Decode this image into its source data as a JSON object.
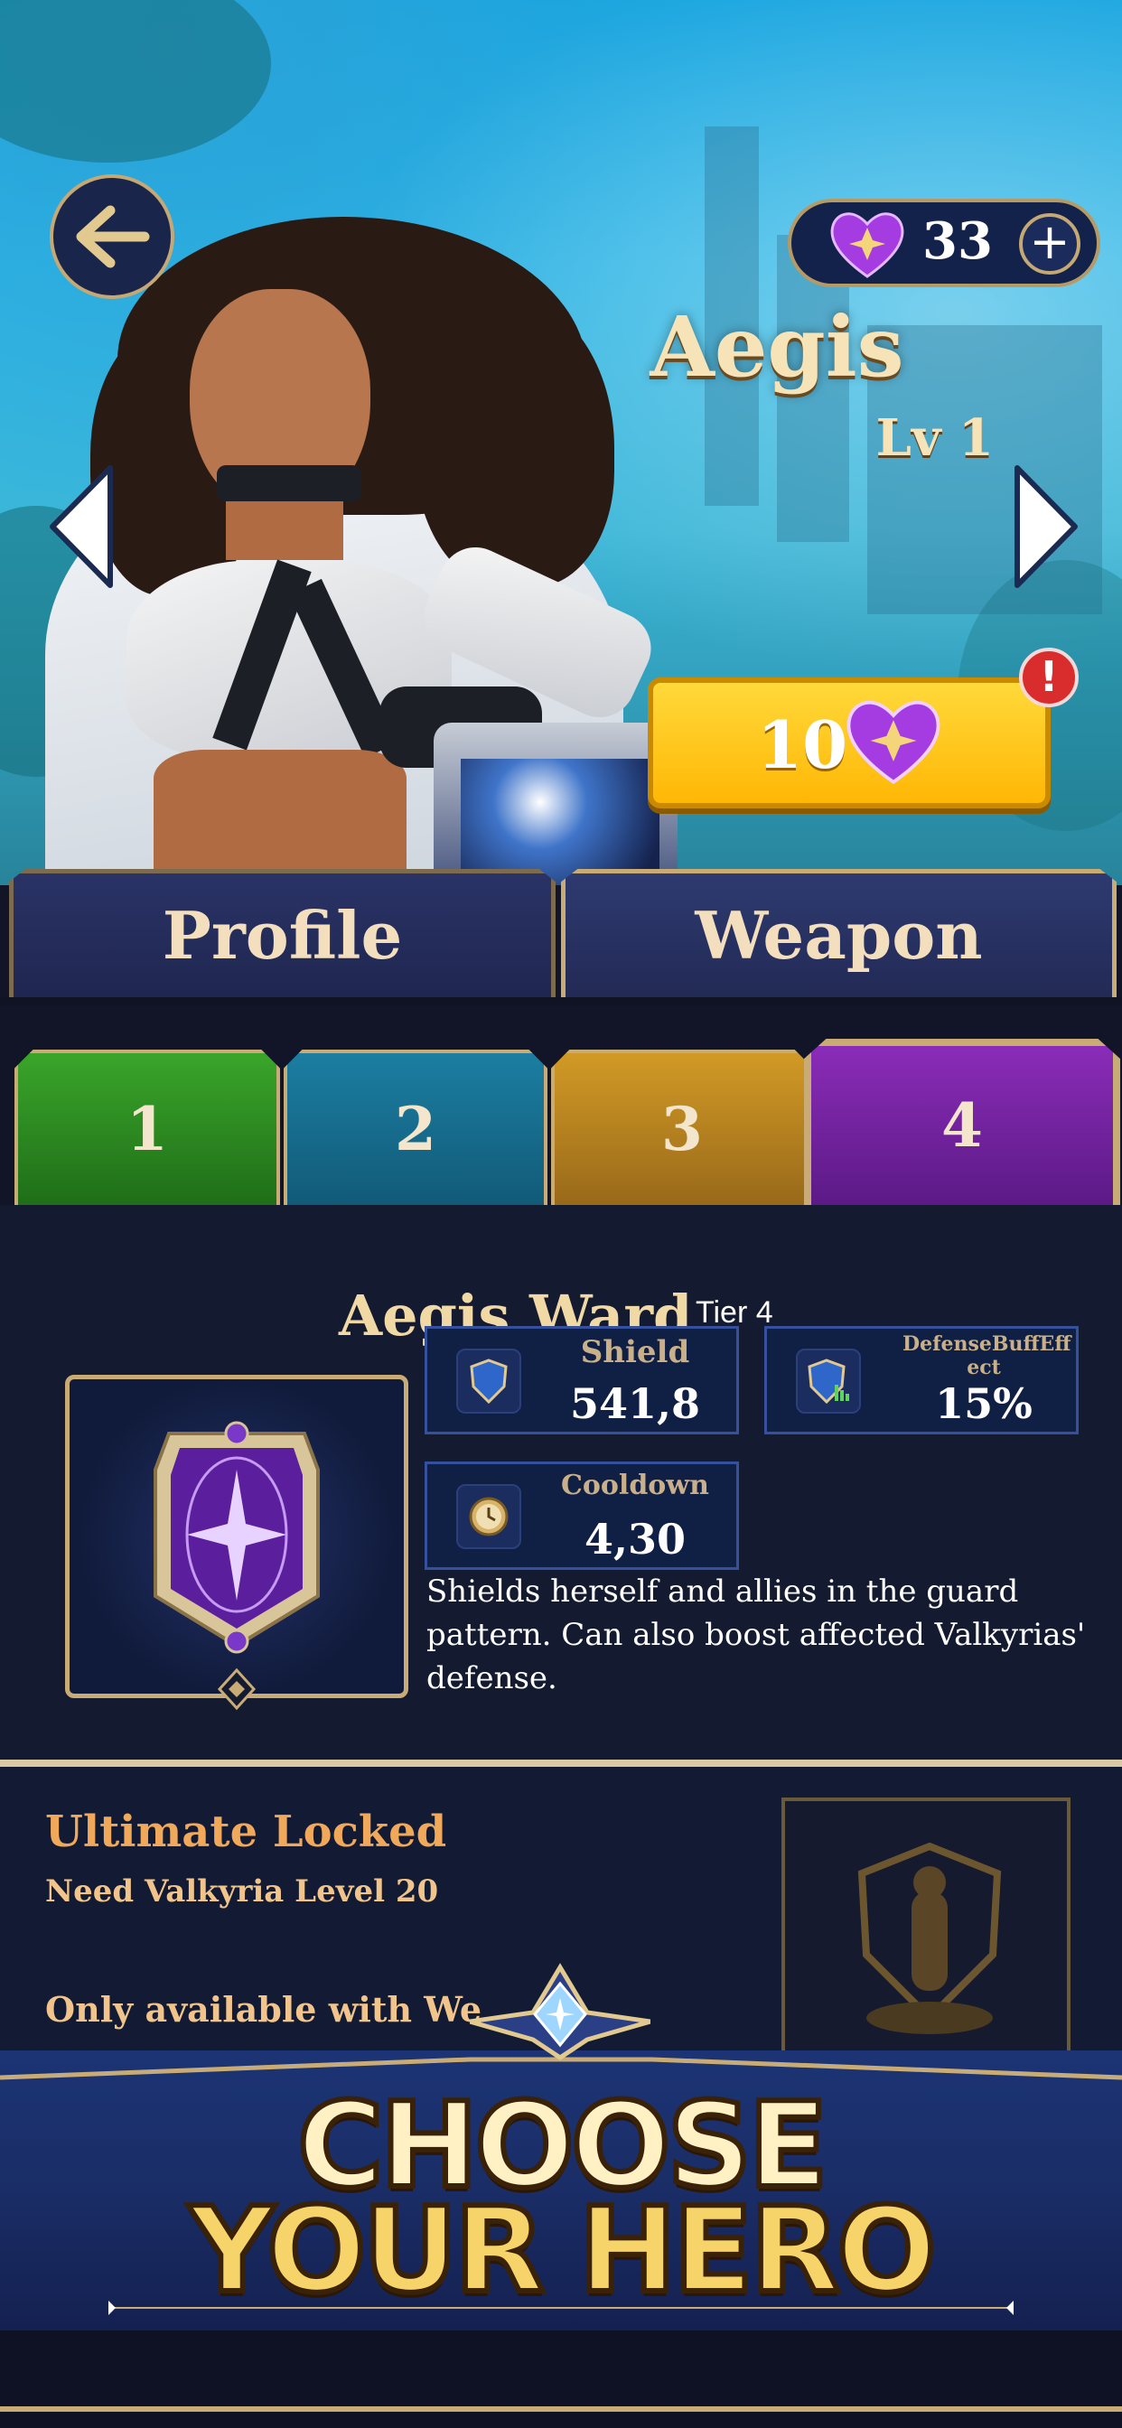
{
  "header": {
    "gem_count": "33",
    "gem_plus_label": "+",
    "hero_name": "Aegis",
    "hero_level": "Lv 1",
    "buy_price": "10",
    "alert_symbol": "!"
  },
  "tabs": [
    {
      "label": "Profile",
      "active": false
    },
    {
      "label": "Weapon",
      "active": true
    }
  ],
  "tiers": [
    {
      "label": "1",
      "color": "#2f8f22"
    },
    {
      "label": "2",
      "color": "#176c8f"
    },
    {
      "label": "3",
      "color": "#b7841f"
    },
    {
      "label": "4",
      "color": "#7a24a8",
      "active": true
    }
  ],
  "weapon": {
    "name": "Aegis Ward",
    "tier": "Tier 4",
    "stats": [
      {
        "label": "Shield",
        "value": "541,8",
        "icon": "shield-icon"
      },
      {
        "label": "DefenseBuffEff ect",
        "value": "15%",
        "icon": "shield-buff-icon"
      },
      {
        "label": "Cooldown",
        "value": "4,30",
        "icon": "clock-icon"
      }
    ],
    "description": "Shields herself and allies in the guard pattern. Can also boost affected Valkyrias' defense."
  },
  "ultimate": {
    "title": "Ultimate Locked",
    "requirement": "Need Valkyria Level 20",
    "note": "Only available with We"
  },
  "banner": {
    "line1": "CHOOSE",
    "line2": "YOUR HERO"
  },
  "colors": {
    "accent_gold": "#c8ab75",
    "buy_yellow": "#ffc41a",
    "gem_purple": "#a23be0"
  }
}
